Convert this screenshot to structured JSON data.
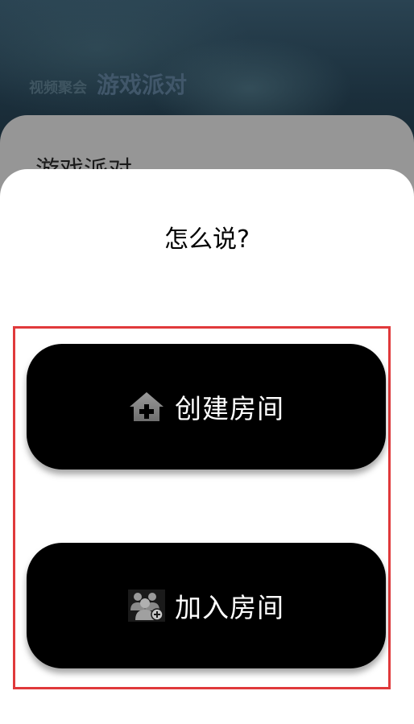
{
  "header": {
    "subtitle": "视频聚会",
    "title": "游戏派对"
  },
  "background_card": {
    "title": "游戏派对"
  },
  "sheet": {
    "title": "怎么说?",
    "actions": [
      {
        "label": "创建房间",
        "icon": "house-plus-icon"
      },
      {
        "label": "加入房间",
        "icon": "group-add-icon"
      }
    ]
  },
  "colors": {
    "button_bg": "#000000",
    "highlight_border": "#e0393b",
    "sheet_bg": "#ffffff",
    "dim_card": "#969696"
  }
}
